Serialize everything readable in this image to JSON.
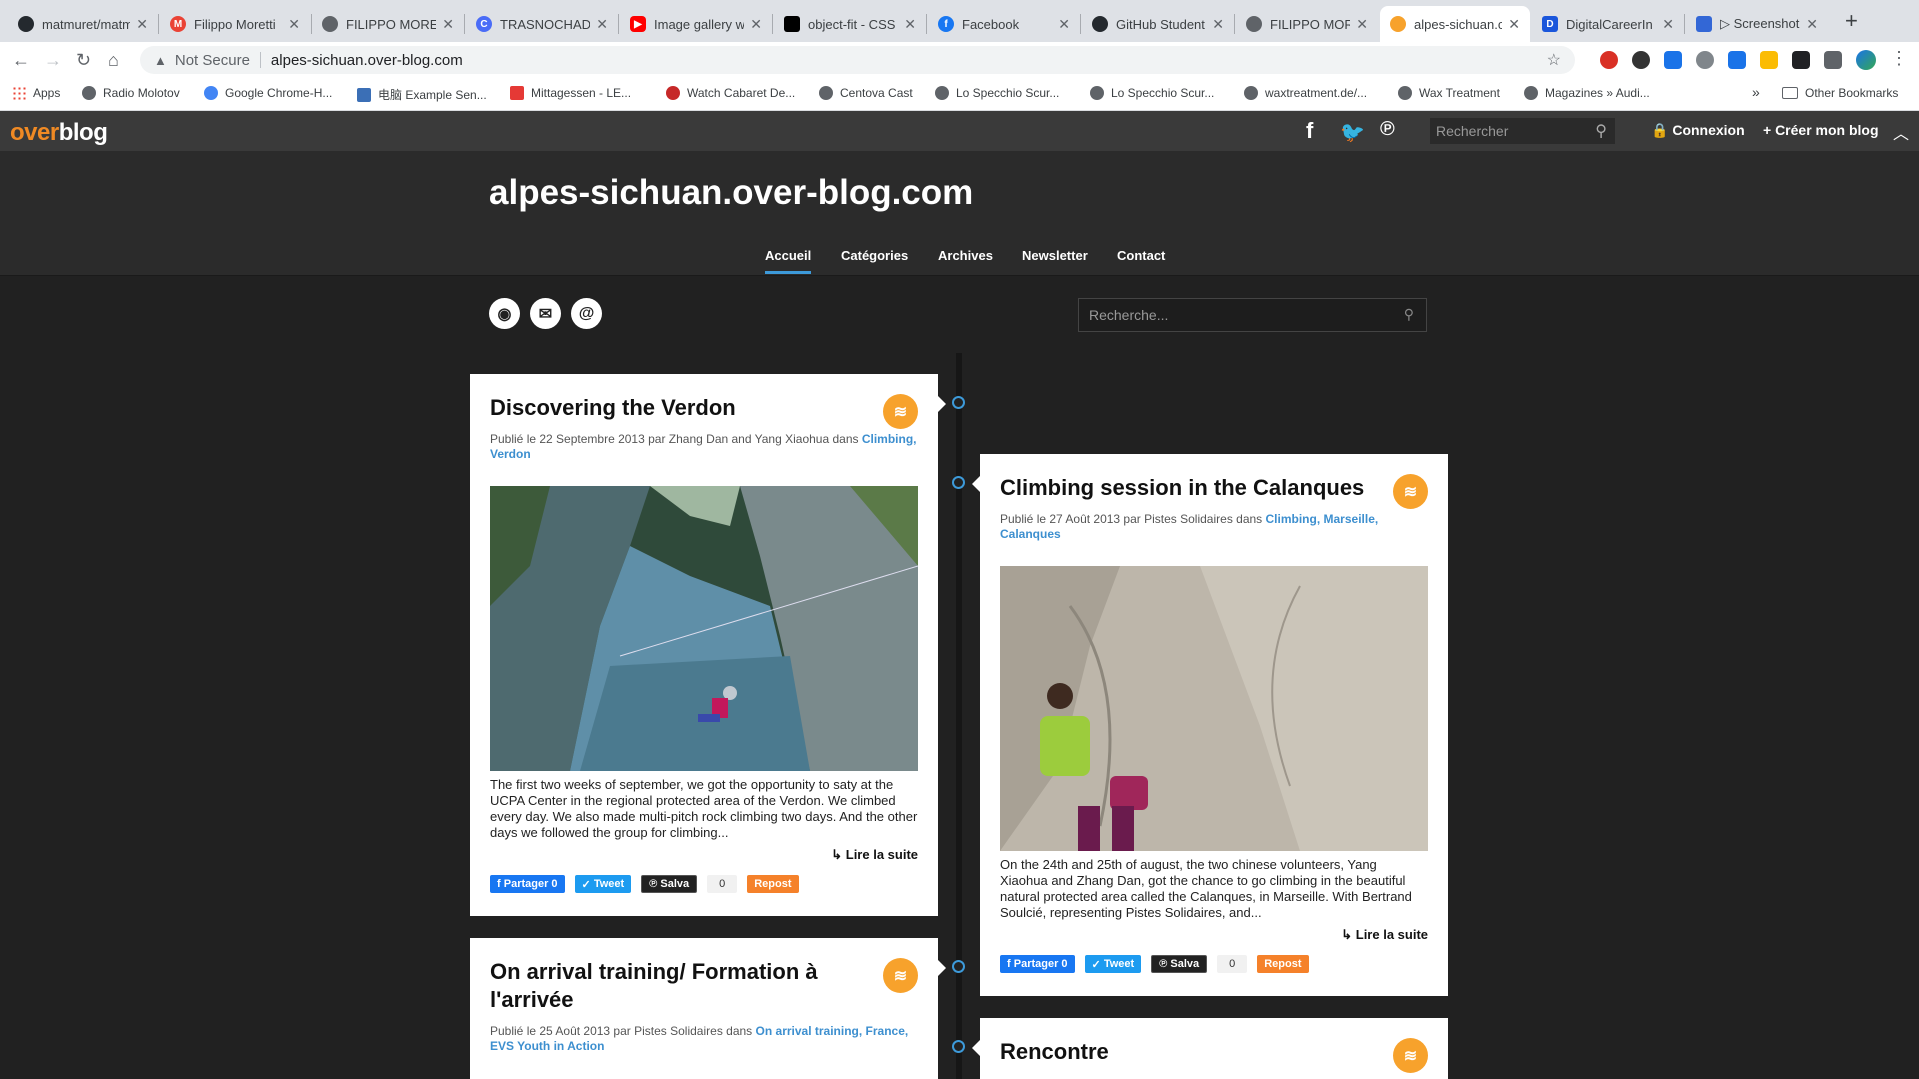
{
  "browser": {
    "tabs": [
      {
        "label": "matmuret/matm",
        "icon": "github-icon",
        "color": "#24292e"
      },
      {
        "label": "Filippo Moretti",
        "icon": "gmail-icon",
        "color": "#ea4335"
      },
      {
        "label": "FILIPPO MORET",
        "icon": "globe-icon",
        "color": "#5f6368"
      },
      {
        "label": "TRASNOCHAD",
        "icon": "c-icon",
        "color": "#4a6cf7"
      },
      {
        "label": "Image gallery w",
        "icon": "youtube-icon",
        "color": "#ff0000"
      },
      {
        "label": "object-fit - CSS",
        "icon": "mdn-icon",
        "color": "#000000"
      },
      {
        "label": "Facebook",
        "icon": "facebook-icon",
        "color": "#1877f2"
      },
      {
        "label": "GitHub Student",
        "icon": "github-icon",
        "color": "#24292e"
      },
      {
        "label": "FILIPPO MORET",
        "icon": "globe-icon",
        "color": "#5f6368"
      },
      {
        "label": "alpes-sichuan.c",
        "icon": "overblog-icon",
        "color": "#f7a22c"
      },
      {
        "label": "DigitalCareerIn",
        "icon": "dci-icon",
        "color": "#1a56db"
      },
      {
        "label": "▷ Screenshot o",
        "icon": "screenshot-icon",
        "color": "#3367d6"
      }
    ],
    "url": "alpes-sichuan.over-blog.com",
    "security": "Not Secure",
    "bookmarks": [
      {
        "label": "Apps"
      },
      {
        "label": "Radio Molotov"
      },
      {
        "label": "Google Chrome-H..."
      },
      {
        "label": "电脑 Example Sen..."
      },
      {
        "label": "Mittagessen - LE..."
      },
      {
        "label": "Watch Cabaret De..."
      },
      {
        "label": "Centova Cast"
      },
      {
        "label": "Lo Specchio Scur..."
      },
      {
        "label": "Lo Specchio Scur..."
      },
      {
        "label": "waxtreatment.de/..."
      },
      {
        "label": "Wax Treatment"
      },
      {
        "label": "Magazines » Audi..."
      }
    ],
    "overflow": "»",
    "other_bookmarks": "Other Bookmarks"
  },
  "overblog": {
    "logo_a": "over",
    "logo_b": "blog",
    "search_placeholder": "Rechercher",
    "login": "Connexion",
    "create": "+ Créer mon blog"
  },
  "blog": {
    "title": "alpes-sichuan.over-blog.com",
    "menu": [
      "Accueil",
      "Catégories",
      "Archives",
      "Newsletter",
      "Contact"
    ],
    "search_placeholder": "Recherche..."
  },
  "posts": [
    {
      "title": "Discovering the Verdon",
      "meta": "Publié le 22 Septembre 2013 par Zhang Dan and Yang Xiaohua dans ",
      "categories": "Climbing, Verdon",
      "excerpt": "The first two weeks of september, we got the opportunity to saty at the UCPA Center in the regional protected area of the Verdon. We climbed every day. We also made multi-pitch rock climbing two days. And the other days we followed the group for climbing...",
      "readmore": "Lire la suite",
      "share_fb": "Partager 0",
      "share_tw": "Tweet",
      "share_pin": "Salva",
      "pin_count": "0",
      "repost": "Repost"
    },
    {
      "title": "Climbing session in the Calanques",
      "meta": "Publié le 27 Août 2013 par Pistes Solidaires dans ",
      "categories": "Climbing, Marseille, Calanques",
      "excerpt": "On the 24th and 25th of august, the two chinese volunteers, Yang Xiaohua and Zhang Dan, got the chance to go climbing in the beautiful natural protected area called the Calanques, in Marseille. With Bertrand Soulcié, representing Pistes Solidaires, and...",
      "readmore": "Lire la suite",
      "share_fb": "Partager 0",
      "share_tw": "Tweet",
      "share_pin": "Salva",
      "pin_count": "0",
      "repost": "Repost"
    },
    {
      "title": "On arrival training/ Formation à l'arrivée",
      "meta": "Publié le 25 Août 2013 par Pistes Solidaires dans ",
      "categories": "On arrival training, France, EVS Youth in Action"
    },
    {
      "title": "Rencontre"
    }
  ]
}
